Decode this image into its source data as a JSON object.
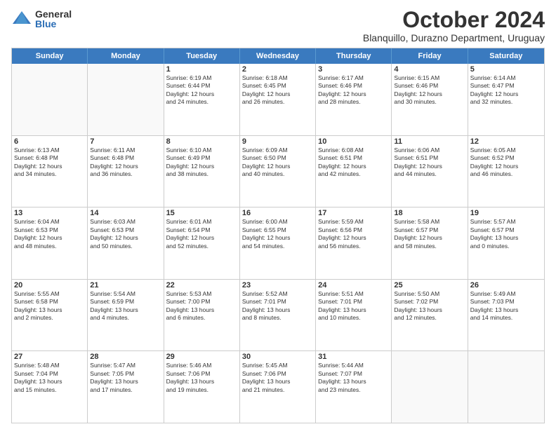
{
  "logo": {
    "general": "General",
    "blue": "Blue"
  },
  "header": {
    "title": "October 2024",
    "location": "Blanquillo, Durazno Department, Uruguay"
  },
  "days_of_week": [
    "Sunday",
    "Monday",
    "Tuesday",
    "Wednesday",
    "Thursday",
    "Friday",
    "Saturday"
  ],
  "weeks": [
    [
      {
        "day": "",
        "content": ""
      },
      {
        "day": "",
        "content": ""
      },
      {
        "day": "1",
        "content": "Sunrise: 6:19 AM\nSunset: 6:44 PM\nDaylight: 12 hours\nand 24 minutes."
      },
      {
        "day": "2",
        "content": "Sunrise: 6:18 AM\nSunset: 6:45 PM\nDaylight: 12 hours\nand 26 minutes."
      },
      {
        "day": "3",
        "content": "Sunrise: 6:17 AM\nSunset: 6:46 PM\nDaylight: 12 hours\nand 28 minutes."
      },
      {
        "day": "4",
        "content": "Sunrise: 6:15 AM\nSunset: 6:46 PM\nDaylight: 12 hours\nand 30 minutes."
      },
      {
        "day": "5",
        "content": "Sunrise: 6:14 AM\nSunset: 6:47 PM\nDaylight: 12 hours\nand 32 minutes."
      }
    ],
    [
      {
        "day": "6",
        "content": "Sunrise: 6:13 AM\nSunset: 6:48 PM\nDaylight: 12 hours\nand 34 minutes."
      },
      {
        "day": "7",
        "content": "Sunrise: 6:11 AM\nSunset: 6:48 PM\nDaylight: 12 hours\nand 36 minutes."
      },
      {
        "day": "8",
        "content": "Sunrise: 6:10 AM\nSunset: 6:49 PM\nDaylight: 12 hours\nand 38 minutes."
      },
      {
        "day": "9",
        "content": "Sunrise: 6:09 AM\nSunset: 6:50 PM\nDaylight: 12 hours\nand 40 minutes."
      },
      {
        "day": "10",
        "content": "Sunrise: 6:08 AM\nSunset: 6:51 PM\nDaylight: 12 hours\nand 42 minutes."
      },
      {
        "day": "11",
        "content": "Sunrise: 6:06 AM\nSunset: 6:51 PM\nDaylight: 12 hours\nand 44 minutes."
      },
      {
        "day": "12",
        "content": "Sunrise: 6:05 AM\nSunset: 6:52 PM\nDaylight: 12 hours\nand 46 minutes."
      }
    ],
    [
      {
        "day": "13",
        "content": "Sunrise: 6:04 AM\nSunset: 6:53 PM\nDaylight: 12 hours\nand 48 minutes."
      },
      {
        "day": "14",
        "content": "Sunrise: 6:03 AM\nSunset: 6:53 PM\nDaylight: 12 hours\nand 50 minutes."
      },
      {
        "day": "15",
        "content": "Sunrise: 6:01 AM\nSunset: 6:54 PM\nDaylight: 12 hours\nand 52 minutes."
      },
      {
        "day": "16",
        "content": "Sunrise: 6:00 AM\nSunset: 6:55 PM\nDaylight: 12 hours\nand 54 minutes."
      },
      {
        "day": "17",
        "content": "Sunrise: 5:59 AM\nSunset: 6:56 PM\nDaylight: 12 hours\nand 56 minutes."
      },
      {
        "day": "18",
        "content": "Sunrise: 5:58 AM\nSunset: 6:57 PM\nDaylight: 12 hours\nand 58 minutes."
      },
      {
        "day": "19",
        "content": "Sunrise: 5:57 AM\nSunset: 6:57 PM\nDaylight: 13 hours\nand 0 minutes."
      }
    ],
    [
      {
        "day": "20",
        "content": "Sunrise: 5:55 AM\nSunset: 6:58 PM\nDaylight: 13 hours\nand 2 minutes."
      },
      {
        "day": "21",
        "content": "Sunrise: 5:54 AM\nSunset: 6:59 PM\nDaylight: 13 hours\nand 4 minutes."
      },
      {
        "day": "22",
        "content": "Sunrise: 5:53 AM\nSunset: 7:00 PM\nDaylight: 13 hours\nand 6 minutes."
      },
      {
        "day": "23",
        "content": "Sunrise: 5:52 AM\nSunset: 7:01 PM\nDaylight: 13 hours\nand 8 minutes."
      },
      {
        "day": "24",
        "content": "Sunrise: 5:51 AM\nSunset: 7:01 PM\nDaylight: 13 hours\nand 10 minutes."
      },
      {
        "day": "25",
        "content": "Sunrise: 5:50 AM\nSunset: 7:02 PM\nDaylight: 13 hours\nand 12 minutes."
      },
      {
        "day": "26",
        "content": "Sunrise: 5:49 AM\nSunset: 7:03 PM\nDaylight: 13 hours\nand 14 minutes."
      }
    ],
    [
      {
        "day": "27",
        "content": "Sunrise: 5:48 AM\nSunset: 7:04 PM\nDaylight: 13 hours\nand 15 minutes."
      },
      {
        "day": "28",
        "content": "Sunrise: 5:47 AM\nSunset: 7:05 PM\nDaylight: 13 hours\nand 17 minutes."
      },
      {
        "day": "29",
        "content": "Sunrise: 5:46 AM\nSunset: 7:06 PM\nDaylight: 13 hours\nand 19 minutes."
      },
      {
        "day": "30",
        "content": "Sunrise: 5:45 AM\nSunset: 7:06 PM\nDaylight: 13 hours\nand 21 minutes."
      },
      {
        "day": "31",
        "content": "Sunrise: 5:44 AM\nSunset: 7:07 PM\nDaylight: 13 hours\nand 23 minutes."
      },
      {
        "day": "",
        "content": ""
      },
      {
        "day": "",
        "content": ""
      }
    ]
  ]
}
